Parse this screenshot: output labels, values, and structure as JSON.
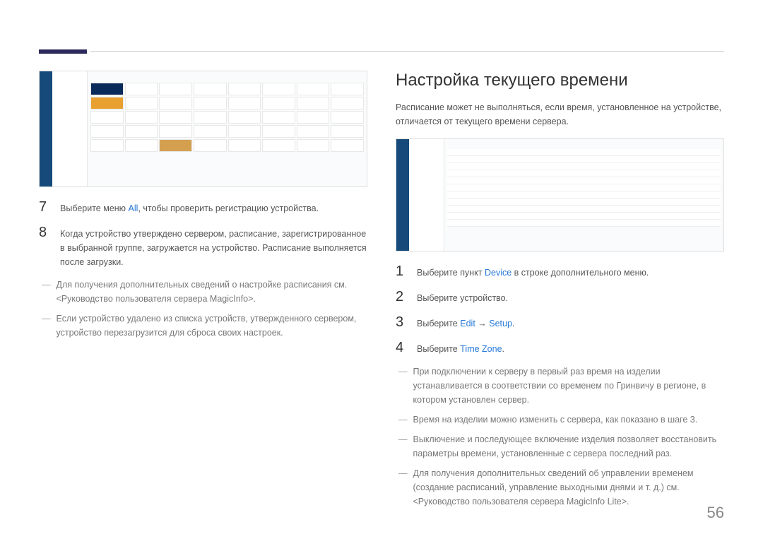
{
  "page_number": "56",
  "left": {
    "step7_num": "7",
    "step7_pre": "Выберите меню ",
    "step7_link": "All",
    "step7_post": ", чтобы проверить регистрацию устройства.",
    "step8_num": "8",
    "step8_text": "Когда устройство утверждено сервером, расписание, зарегистрированное в выбранной группе, загружается на устройство. Расписание выполняется после загрузки.",
    "note1": "Для получения дополнительных сведений о настройке расписания см. <Руководство пользователя сервера MagicInfo>.",
    "note2": "Если устройство удалено из списка устройств, утвержденного сервером, устройство перезагрузится для сброса своих настроек."
  },
  "right": {
    "heading": "Настройка текущего времени",
    "intro": "Расписание может не выполняться, если время, установленное на устройстве, отличается от текущего времени сервера.",
    "s1_num": "1",
    "s1_pre": "Выберите пункт ",
    "s1_link": "Device",
    "s1_post": " в строке дополнительного меню.",
    "s2_num": "2",
    "s2_text": "Выберите устройство.",
    "s3_num": "3",
    "s3_pre": "Выберите ",
    "s3_link1": "Edit",
    "s3_arrow": " → ",
    "s3_link2": "Setup",
    "s3_post": ".",
    "s4_num": "4",
    "s4_pre": "Выберите ",
    "s4_link": "Time Zone",
    "s4_post": ".",
    "note1": "При подключении к серверу в первый раз время на изделии устанавливается в соответствии со временем по Гринвичу в регионе, в котором установлен сервер.",
    "note2": "Время на изделии можно изменить с сервера, как показано в шаге 3.",
    "note3": "Выключение и последующее включение изделия позволяет восстановить параметры времени, установленные с сервера последний раз.",
    "note4": "Для получения дополнительных сведений об управлении временем (создание расписаний, управление выходными днями и т. д.) см.<Руководство пользователя сервера MagicInfo Lite>."
  }
}
